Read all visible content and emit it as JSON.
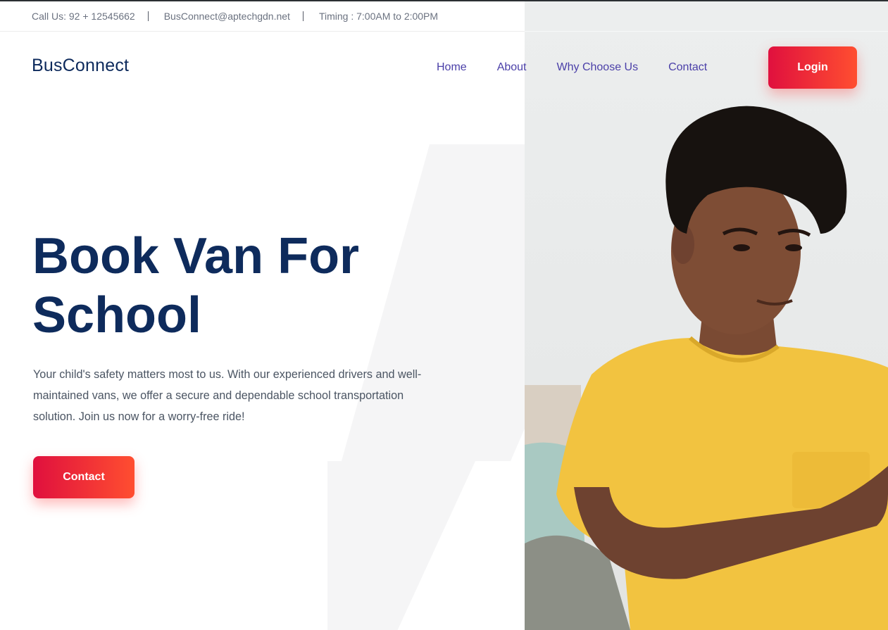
{
  "topbar": {
    "call": "Call Us: 92 + 12545662",
    "email": "BusConnect@aptechgdn.net",
    "timing": "Timing : 7:00AM to 2:00PM"
  },
  "brand": "BusConnect",
  "nav": {
    "items": [
      {
        "label": "Home"
      },
      {
        "label": "About"
      },
      {
        "label": "Why Choose Us"
      },
      {
        "label": "Contact"
      }
    ],
    "login_label": "Login"
  },
  "hero": {
    "title_line1": "Book Van For",
    "title_line2": "School",
    "description": "Your child's safety matters most to us. With our experienced drivers and well-maintained vans, we offer a secure and dependable school transportation solution. Join us now for a worry-free ride!",
    "contact_label": "Contact"
  },
  "colors": {
    "brand_navy": "#0e2b5c",
    "nav_link": "#4a3fa8",
    "button_gradient_start": "#e0103e",
    "button_gradient_end": "#ff4e30",
    "shirt_yellow": "#f2c340"
  }
}
